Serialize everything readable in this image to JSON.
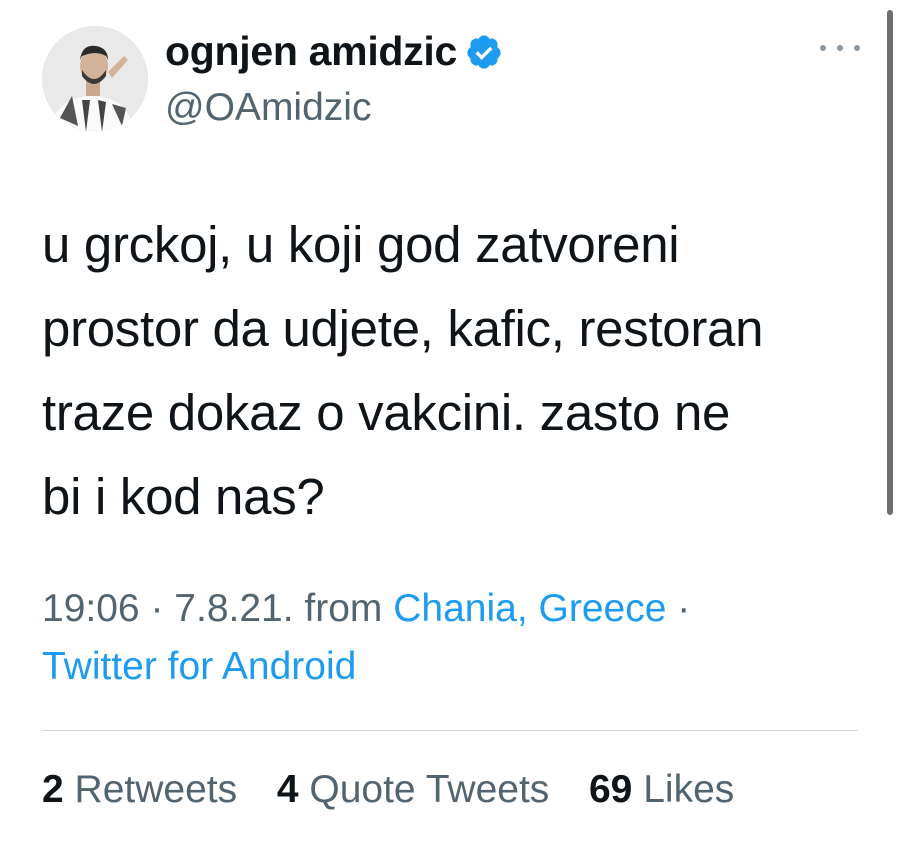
{
  "author": {
    "display_name": "ognjen amidzic",
    "handle": "@OAmidzic",
    "verified": true,
    "avatar_icon": "avatar-photo",
    "verified_icon": "verified-badge-icon",
    "verified_color": "#1d9bf0"
  },
  "menu": {
    "more_icon": "more-options-icon"
  },
  "tweet": {
    "lines": [
      "u grckoj, u koji god zatvoreni",
      "prostor da udjete, kafic, restoran",
      "traze dokaz o vakcini. zasto ne",
      "bi i kod nas?"
    ]
  },
  "meta": {
    "time": "19:06",
    "separator": "·",
    "date": "7.8.21.",
    "from_label": "from",
    "location": "Chania, Greece",
    "source": "Twitter for Android",
    "link_color": "#1d9bf0"
  },
  "stats": {
    "retweets_count": "2",
    "retweets_label": "Retweets",
    "quotes_count": "4",
    "quotes_label": "Quote Tweets",
    "likes_count": "69",
    "likes_label": "Likes"
  }
}
